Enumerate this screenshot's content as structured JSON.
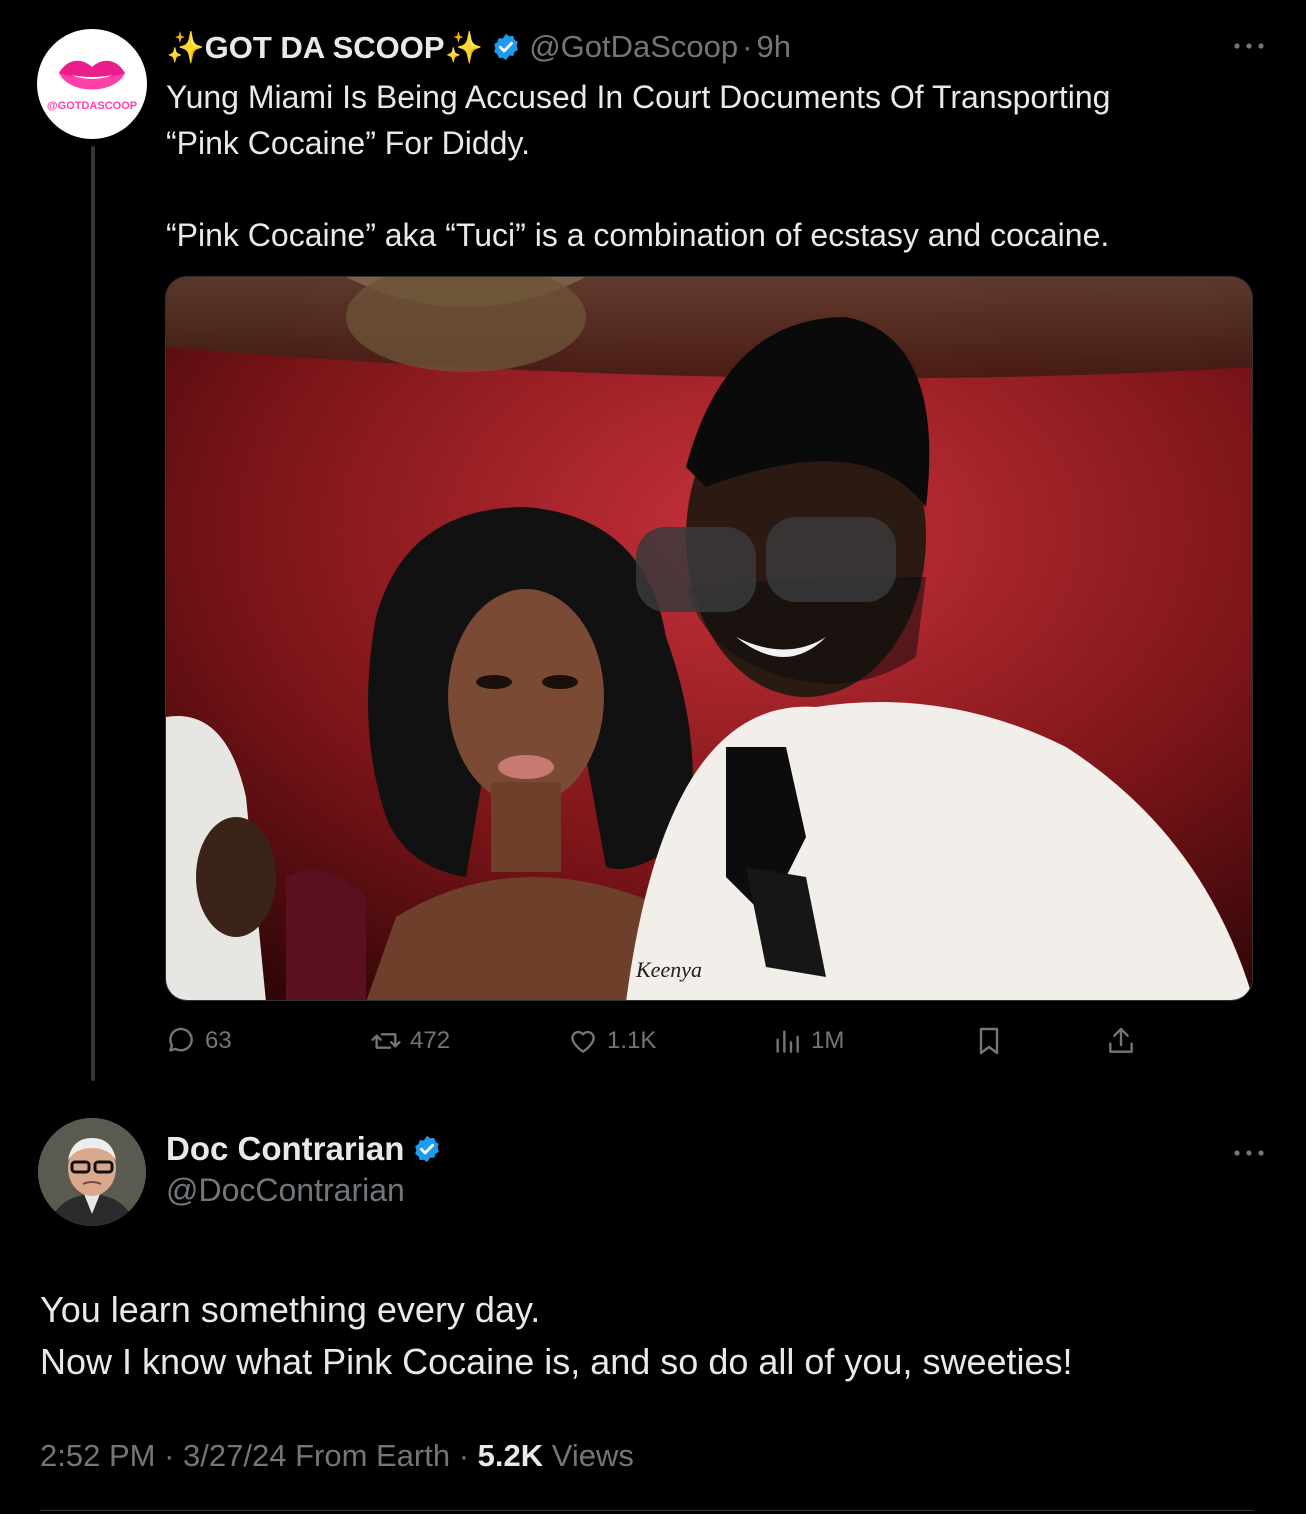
{
  "tweet1": {
    "name": "✨GOT DA SCOOP✨",
    "handle": "@GotDaScoop",
    "time_sep": "·",
    "time": "9h",
    "avatar_text": "@GOTDASCOOP",
    "text_lines": [
      "Yung Miami Is Being Accused In Court Documents Of Transporting",
      "“Pink Cocaine” For Diddy.",
      "“Pink Cocaine” aka “Tuci” is a combination of ecstasy and cocaine."
    ],
    "media_text": "Keenya",
    "actions": {
      "replies": "63",
      "reposts": "472",
      "likes": "1.1K",
      "views": "1M"
    }
  },
  "tweet2": {
    "name": "Doc Contrarian",
    "handle": "@DocContrarian",
    "text_lines": [
      "You learn something every day.",
      "Now I know what Pink Cocaine is, and so do all of you, sweeties!"
    ],
    "meta": {
      "time": "2:52 PM",
      "sep1": " · ",
      "date": "3/27/24",
      "source": " From Earth",
      "sep2": " · ",
      "views_count": "5.2K",
      "views_label": " Views"
    }
  },
  "colors": {
    "background": "#000000",
    "text": "#e7e9ea",
    "muted": "#71767b",
    "verified": "#1d9bf0",
    "thread_line": "#333639"
  },
  "icons": [
    "verified-badge-icon",
    "more-icon",
    "reply-icon",
    "repost-icon",
    "like-icon",
    "views-icon",
    "bookmark-icon",
    "share-icon"
  ]
}
